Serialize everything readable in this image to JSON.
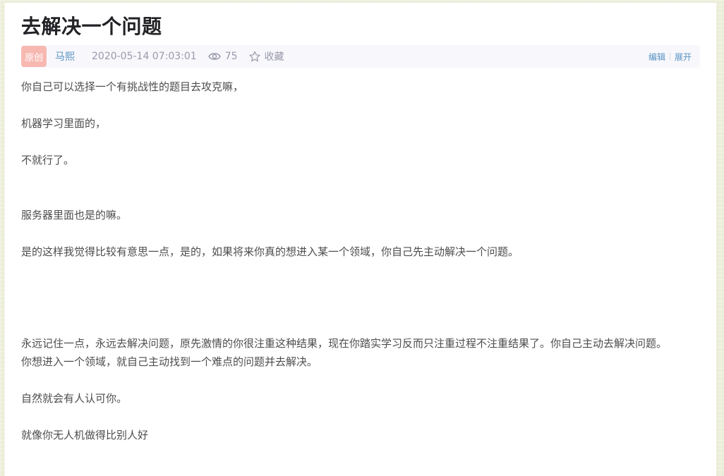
{
  "article": {
    "title": "去解决一个问题",
    "badge": "原创",
    "author": "马熙",
    "datetime": "2020-05-14 07:03:01",
    "views": "75",
    "collect_label": "收藏",
    "edit_label": "编辑",
    "expand_label": "展开",
    "paragraphs": [
      "你自己可以选择一个有挑战性的题目去攻克嘛，",
      "机器学习里面的，",
      "不就行了。",
      "服务器里面也是的嘛。",
      "是的这样我觉得比较有意思一点，是的，如果将来你真的想进入某一个领域，你自己先主动解决一个问题。",
      "永远记住一点，永远去解决问题，原先激情的你很注重这种结果，现在你踏实学习反而只注重过程不注重结果了。你自己主动去解决问题。",
      "你想进入一个领域，就自己主动找到一个难点的问题并去解决。",
      "自然就会有人认可你。",
      "就像你无人机做得比别人好"
    ]
  },
  "colors": {
    "background": "#ebedd8",
    "badge": "#f7b8b1",
    "link": "#5893c2",
    "meta_text": "#999aaa",
    "body_text": "#4d4d4d"
  },
  "icons": {
    "views": "eye-icon",
    "collect": "star-icon"
  }
}
